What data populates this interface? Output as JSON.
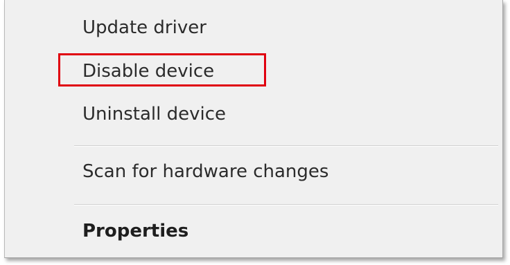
{
  "context_menu": {
    "items": [
      {
        "label": "Update driver"
      },
      {
        "label": "Disable device"
      },
      {
        "label": "Uninstall device"
      },
      {
        "label": "Scan for hardware changes"
      },
      {
        "label": "Properties"
      }
    ],
    "default_item": "Properties"
  },
  "annotation": {
    "highlight_target": "Disable device",
    "highlight_color": "#e0000f"
  }
}
